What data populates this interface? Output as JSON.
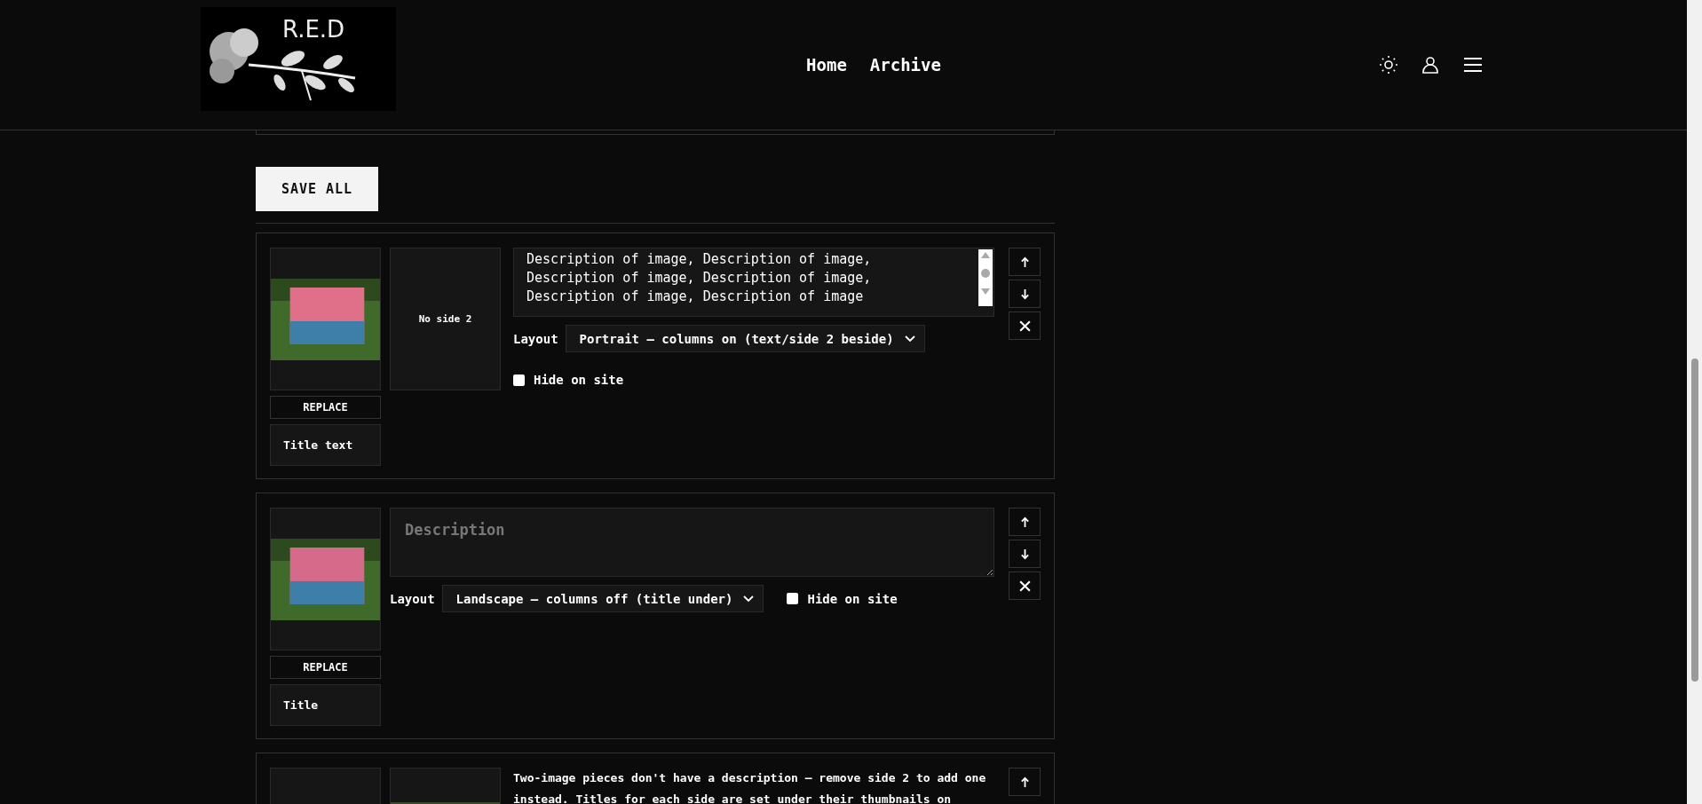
{
  "header": {
    "logo_text": "R.E.D",
    "nav": [
      {
        "label": "Home"
      },
      {
        "label": "Archive"
      }
    ]
  },
  "save_button": "SAVE ALL",
  "pieces": [
    {
      "kind": "with_side2",
      "side2_text": "No side 2",
      "replace": "REPLACE",
      "title": "Title text",
      "description": "Description of image, Description of image,\nDescription of image, Description of image,\nDescription of image, Description of image",
      "layout_label": "Layout",
      "layout": "Portrait – columns on (text/side 2 beside)",
      "hide_label": "Hide on site",
      "hidden": false
    },
    {
      "kind": "single",
      "replace": "REPLACE",
      "title": "Title",
      "description_placeholder": "Description",
      "layout_label": "Layout",
      "layout": "Landscape – columns off (title under)",
      "hide_label": "Hide on site",
      "hidden": false
    },
    {
      "kind": "two_image",
      "note": "Two-image pieces don't have a description – remove side 2 to add one instead. Titles for each side are set under their thumbnails on"
    }
  ]
}
